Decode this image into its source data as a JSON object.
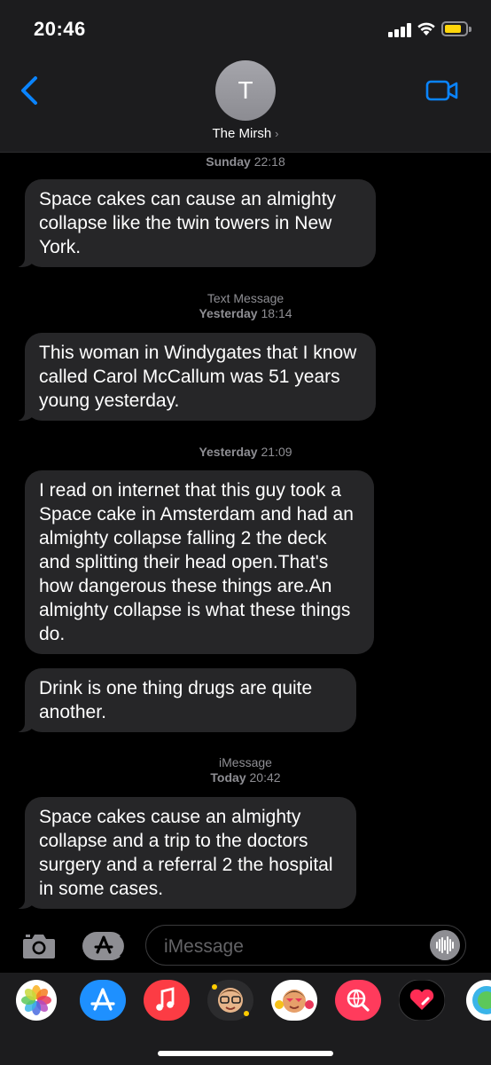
{
  "status_bar": {
    "time": "20:46"
  },
  "header": {
    "avatar_initial": "T",
    "contact_name": "The Mirsh",
    "chevron": "›"
  },
  "messages": [
    {
      "type": "timestamp",
      "day": "Sunday",
      "time": "22:18"
    },
    {
      "type": "bubble",
      "text": "Space cakes can cause an almighty collapse like the twin towers in New York."
    },
    {
      "type": "timestamp",
      "service": "Text Message",
      "day": "Yesterday",
      "time": "18:14"
    },
    {
      "type": "bubble",
      "text": "This woman in Windygates that I know called Carol McCallum was 51 years young yesterday."
    },
    {
      "type": "timestamp",
      "day": "Yesterday",
      "time": "21:09"
    },
    {
      "type": "bubble",
      "text": "I read on internet that this guy took a Space cake in Amsterdam and had an almighty collapse falling 2 the deck and splitting their head open.That's how dangerous these things are.An almighty collapse is what these things do."
    },
    {
      "type": "bubble",
      "text": "Drink is one thing drugs are quite another."
    },
    {
      "type": "timestamp",
      "service": "iMessage",
      "day": "Today",
      "time": "20:42"
    },
    {
      "type": "bubble",
      "text": "Space cakes cause an almighty collapse and a trip to the doctors surgery and a referral 2  the hospital in some cases."
    }
  ],
  "input": {
    "placeholder": "iMessage"
  },
  "app_drawer": {
    "apps": [
      {
        "icon": "photos-icon",
        "bg": "#ffffff"
      },
      {
        "icon": "app-store-icon",
        "bg": "#1e90ff"
      },
      {
        "icon": "music-icon",
        "bg": "#fc3c44"
      },
      {
        "icon": "memoji-icon",
        "bg": "#2c2c2e"
      },
      {
        "icon": "animoji-icon",
        "bg": "#ffffff"
      },
      {
        "icon": "web-search-icon",
        "bg": "#ff3b5c"
      },
      {
        "icon": "digital-touch-icon",
        "bg": "#000000"
      },
      {
        "icon": "more-apps-icon",
        "bg": "#ffffff"
      }
    ]
  },
  "colors": {
    "accent": "#0a84ff",
    "bubble": "#262628",
    "bar": "#1c1c1e",
    "battery": "#ffd60a"
  }
}
